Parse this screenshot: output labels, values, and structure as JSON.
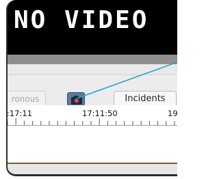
{
  "video": {
    "status_text": "NO VIDEO"
  },
  "toolbar": {
    "sync_label": "ronous",
    "camera_icon": "camera-icon",
    "incidents_label": "Incidents"
  },
  "timeline": {
    "ticks": [
      ":17:11",
      "17:11:50",
      "19"
    ]
  },
  "colors": {
    "pointer_line": "#1aa7d6",
    "video_background": "#000000",
    "camera_button": "#4f6f9a"
  }
}
